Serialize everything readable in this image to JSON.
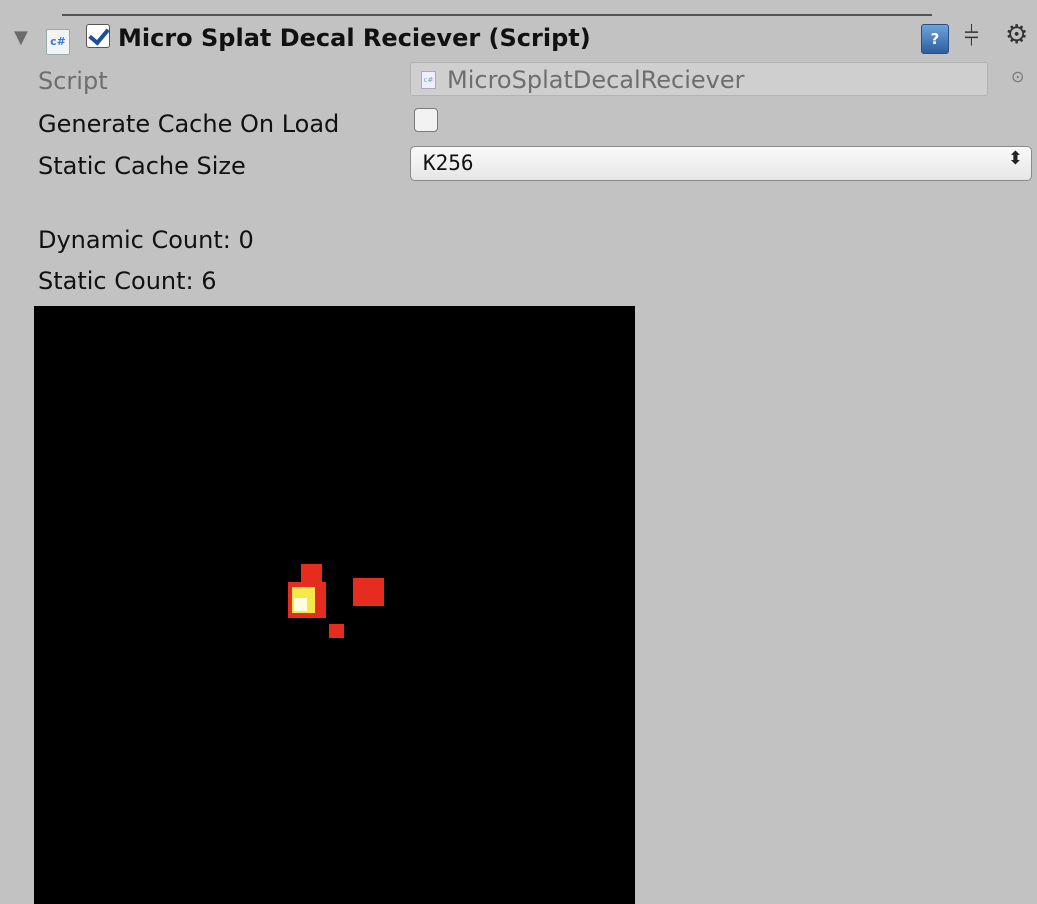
{
  "component": {
    "title": "Micro Splat Decal Reciever (Script)",
    "enabled": true,
    "file_icon_text": "c#",
    "help_icon_text": "?"
  },
  "fields": {
    "script_label": "Script",
    "script_value": "MicroSplatDecalReciever",
    "generate_cache_label": "Generate Cache On Load",
    "generate_cache_checked": false,
    "static_cache_size_label": "Static Cache Size",
    "static_cache_size_value": "K256"
  },
  "stats": {
    "dynamic_count": "Dynamic Count: 0",
    "static_count": "Static Count: 6"
  },
  "icons": [
    "foldout-arrow-icon",
    "csharp-script-icon",
    "help-book-icon",
    "preset-sliders-icon",
    "gear-icon",
    "object-picker-icon",
    "dropdown-arrows-icon"
  ],
  "colors": {
    "panel_bg": "#c2c2c2",
    "preview_bg": "#000000",
    "decal_red": "#e62c1e",
    "decal_yellow": "#f4e84a",
    "decal_white": "#fffde0"
  }
}
